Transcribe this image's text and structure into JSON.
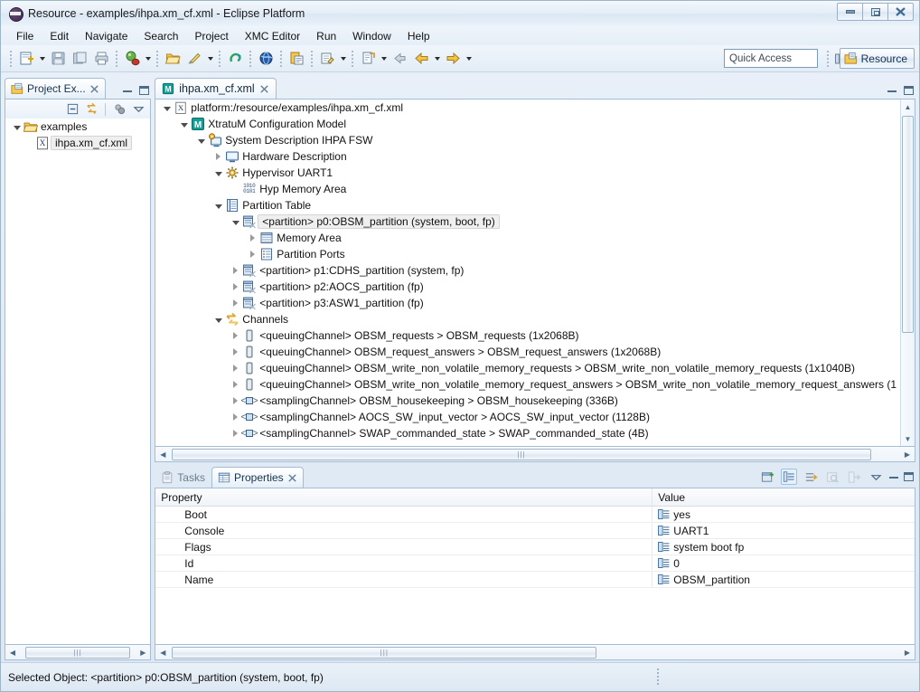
{
  "window": {
    "title": "Resource - examples/ihpa.xm_cf.xml - Eclipse Platform",
    "icon": "eclipse-icon",
    "controls": {
      "minimize": "minimize-icon",
      "maximize": "maximize-icon",
      "close": "close-icon"
    }
  },
  "menubar": {
    "items": [
      "File",
      "Edit",
      "Navigate",
      "Search",
      "Project",
      "XMC Editor",
      "Run",
      "Window",
      "Help"
    ]
  },
  "toolbar": {
    "quick_access_placeholder": "Quick Access",
    "perspective_button": "Resource",
    "open_perspective_icon": "open-perspective-icon",
    "buttons": [
      "new-wizard-icon",
      "save-icon",
      "save-all-icon",
      "print-icon",
      "debug-icon",
      "open-folder-icon",
      "run-icon",
      "undo-icon",
      "globe-icon",
      "paste-icon",
      "annotation-icon",
      "next-annotation-icon",
      "back-icon",
      "previous-edit-icon",
      "forward-icon"
    ]
  },
  "project_explorer": {
    "tab_label": "Project Ex...",
    "tab_icon": "project-explorer-icon",
    "toolbar_icons": [
      "collapse-all-icon",
      "link-with-editor-icon",
      "focus-icon",
      "view-menu-icon"
    ],
    "panel_controls": [
      "minimize-icon",
      "maximize-icon"
    ],
    "tree": [
      {
        "label": "examples",
        "icon": "folder-icon",
        "indent": 0,
        "twisty": "open"
      },
      {
        "label": "ihpa.xm_cf.xml",
        "icon": "xml-file-icon",
        "indent": 1,
        "twisty": "none",
        "selected": true
      }
    ],
    "hscroll": {
      "left_arrow": "scroll-left-icon",
      "right_arrow": "scroll-right-icon",
      "grip": "|||"
    }
  },
  "editor": {
    "tab_label": "ihpa.xm_cf.xml",
    "tab_icon": "xmc-model-icon",
    "close_icon": "close-icon",
    "panel_controls": [
      "minimize-icon",
      "maximize-icon"
    ],
    "tree": [
      {
        "label": "platform:/resource/examples/ihpa.xm_cf.xml",
        "icon": "xml-resource-icon",
        "indent": 0,
        "twisty": "open"
      },
      {
        "label": "XtratuM Configuration Model",
        "icon": "xmc-model-icon",
        "indent": 1,
        "twisty": "open"
      },
      {
        "label": "System Description IHPA FSW",
        "icon": "system-description-icon",
        "indent": 2,
        "twisty": "open"
      },
      {
        "label": "Hardware Description",
        "icon": "hardware-description-icon",
        "indent": 3,
        "twisty": "closed"
      },
      {
        "label": "Hypervisor UART1",
        "icon": "hypervisor-icon",
        "indent": 3,
        "twisty": "open"
      },
      {
        "label": "Hyp Memory Area",
        "icon": "memory-area-icon",
        "indent": 4,
        "twisty": "none"
      },
      {
        "label": "Partition Table",
        "icon": "partition-table-icon",
        "indent": 3,
        "twisty": "open"
      },
      {
        "label": "<partition> p0:OBSM_partition (system, boot, fp)",
        "icon": "partition-icon",
        "indent": 4,
        "twisty": "open",
        "selected": true
      },
      {
        "label": "Memory Area",
        "icon": "memory-table-icon",
        "indent": 5,
        "twisty": "closed"
      },
      {
        "label": "Partition Ports",
        "icon": "partition-ports-icon",
        "indent": 5,
        "twisty": "closed"
      },
      {
        "label": "<partition> p1:CDHS_partition (system, fp)",
        "icon": "partition-icon",
        "indent": 4,
        "twisty": "closed"
      },
      {
        "label": "<partition> p2:AOCS_partition (fp)",
        "icon": "partition-icon",
        "indent": 4,
        "twisty": "closed"
      },
      {
        "label": "<partition> p3:ASW1_partition (fp)",
        "icon": "partition-icon",
        "indent": 4,
        "twisty": "closed"
      },
      {
        "label": "Channels",
        "icon": "channels-icon",
        "indent": 3,
        "twisty": "open"
      },
      {
        "label": "<queuingChannel> OBSM_requests > OBSM_requests (1x2068B)",
        "icon": "queuing-channel-icon",
        "indent": 4,
        "twisty": "closed"
      },
      {
        "label": "<queuingChannel> OBSM_request_answers > OBSM_request_answers (1x2068B)",
        "icon": "queuing-channel-icon",
        "indent": 4,
        "twisty": "closed"
      },
      {
        "label": "<queuingChannel> OBSM_write_non_volatile_memory_requests > OBSM_write_non_volatile_memory_requests (1x1040B)",
        "icon": "queuing-channel-icon",
        "indent": 4,
        "twisty": "closed"
      },
      {
        "label": "<queuingChannel> OBSM_write_non_volatile_memory_request_answers > OBSM_write_non_volatile_memory_request_answers (1",
        "icon": "queuing-channel-icon",
        "indent": 4,
        "twisty": "closed"
      },
      {
        "label": "<samplingChannel> OBSM_housekeeping > OBSM_housekeeping (336B)",
        "icon": "sampling-channel-icon",
        "indent": 4,
        "twisty": "closed"
      },
      {
        "label": "<samplingChannel> AOCS_SW_input_vector > AOCS_SW_input_vector (1128B)",
        "icon": "sampling-channel-icon",
        "indent": 4,
        "twisty": "closed"
      },
      {
        "label": "<samplingChannel> SWAP_commanded_state > SWAP_commanded_state (4B)",
        "icon": "sampling-channel-icon",
        "indent": 4,
        "twisty": "closed"
      }
    ],
    "hscroll": {
      "left_arrow": "scroll-left-icon",
      "right_arrow": "scroll-right-icon",
      "grip": "|||"
    },
    "vscroll": {
      "up_arrow": "scroll-up-icon",
      "down_arrow": "scroll-down-icon"
    }
  },
  "properties_view": {
    "tabs": [
      {
        "label": "Tasks",
        "icon": "tasks-icon",
        "active": false
      },
      {
        "label": "Properties",
        "icon": "properties-icon",
        "active": true
      }
    ],
    "close_icon": "close-icon",
    "toolbar_icons": [
      "new-tab-icon",
      "show-categories-icon",
      "show-advanced-icon",
      "restore-defaults-icon",
      "pin-to-selection-icon",
      "view-menu-icon",
      "minimize-icon",
      "maximize-icon"
    ],
    "columns": {
      "property": "Property",
      "value": "Value"
    },
    "rows": [
      {
        "property": "Boot",
        "value": "yes",
        "value_icon": "property-value-icon"
      },
      {
        "property": "Console",
        "value": "UART1",
        "value_icon": "property-value-icon"
      },
      {
        "property": "Flags",
        "value": "system boot fp",
        "value_icon": "property-value-icon"
      },
      {
        "property": "Id",
        "value": "0",
        "value_icon": "property-value-icon"
      },
      {
        "property": "Name",
        "value": "OBSM_partition",
        "value_icon": "property-value-icon"
      }
    ],
    "hscroll": {
      "left_arrow": "scroll-left-icon",
      "right_arrow": "scroll-right-icon",
      "grip": "|||"
    }
  },
  "statusbar": {
    "text": "Selected Object: <partition> p0:OBSM_partition (system, boot, fp)"
  },
  "colors": {
    "accent": "#2e6ea6",
    "selection": "#efefef",
    "panel_border": "#a5bdd4",
    "title_gradient_top": "#f4f8fc"
  }
}
